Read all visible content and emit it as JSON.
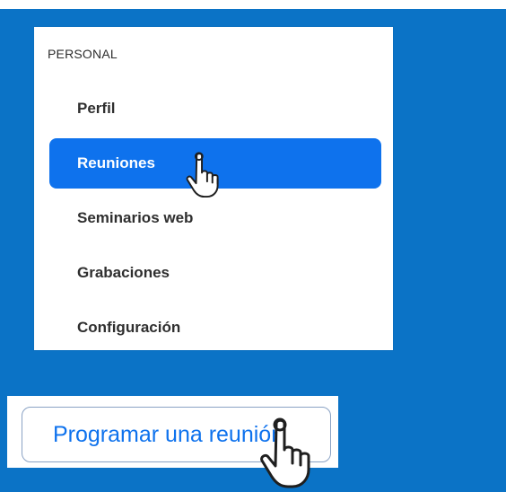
{
  "menu": {
    "section_title": "PERSONAL",
    "items": [
      {
        "label": "Perfil"
      },
      {
        "label": "Reuniones"
      },
      {
        "label": "Seminarios web"
      },
      {
        "label": "Grabaciones"
      },
      {
        "label": "Configuración"
      }
    ]
  },
  "actions": {
    "schedule_label": "Programar una reunión"
  },
  "colors": {
    "background": "#0b73c6",
    "active_item": "#0e72ed",
    "button_text": "#0e72ed"
  },
  "icons": {
    "pointer": "hand-pointer-icon"
  }
}
